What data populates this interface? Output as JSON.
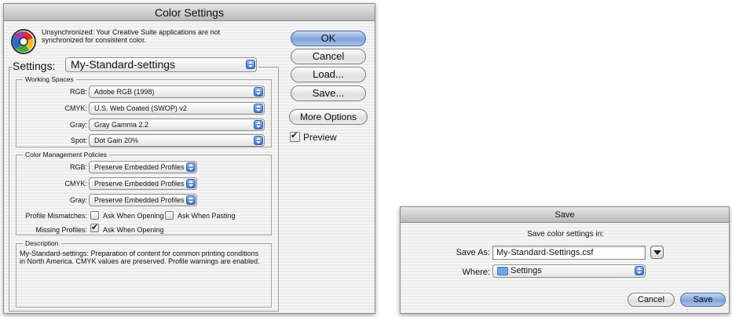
{
  "color_settings": {
    "title": "Color Settings",
    "warning": "Unsynchronized: Your Creative Suite applications are not synchronized for consistent color.",
    "settings_label": "Settings:",
    "settings_value": "My-Standard-settings",
    "working_spaces": {
      "title": "Working Spaces",
      "rows": [
        {
          "label": "RGB:",
          "value": "Adobe RGB (1998)"
        },
        {
          "label": "CMYK:",
          "value": "U.S. Web Coated (SWOP) v2"
        },
        {
          "label": "Gray:",
          "value": "Gray Gamma 2.2"
        },
        {
          "label": "Spot:",
          "value": "Dot Gain 20%"
        }
      ]
    },
    "policies": {
      "title": "Color Management Policies",
      "rows": [
        {
          "label": "RGB:",
          "value": "Preserve Embedded Profiles"
        },
        {
          "label": "CMYK:",
          "value": "Preserve Embedded Profiles"
        },
        {
          "label": "Gray:",
          "value": "Preserve Embedded Profiles"
        }
      ],
      "profile_mismatches_label": "Profile Mismatches:",
      "ask_opening": "Ask When Opening",
      "ask_opening_checked": false,
      "ask_pasting": "Ask When Pasting",
      "ask_pasting_checked": false,
      "missing_profiles_label": "Missing Profiles:",
      "missing_ask_opening": "Ask When Opening",
      "missing_ask_opening_checked": true
    },
    "description": {
      "title": "Description",
      "text": "My-Standard-settings:  Preparation of content for common printing conditions in North America. CMYK values are preserved. Profile warnings are enabled."
    },
    "buttons": {
      "ok": "OK",
      "cancel": "Cancel",
      "load": "Load...",
      "save": "Save...",
      "more_options": "More Options"
    },
    "preview_label": "Preview",
    "preview_checked": true
  },
  "save_dialog": {
    "title": "Save",
    "subtitle": "Save color settings in:",
    "save_as_label": "Save As:",
    "filename": "My-Standard-Settings.csf",
    "where_label": "Where:",
    "where_value": "Settings",
    "cancel": "Cancel",
    "save": "Save"
  },
  "colors": {
    "default_button": "#7fa3d9",
    "folder": "#6fa8e0"
  }
}
